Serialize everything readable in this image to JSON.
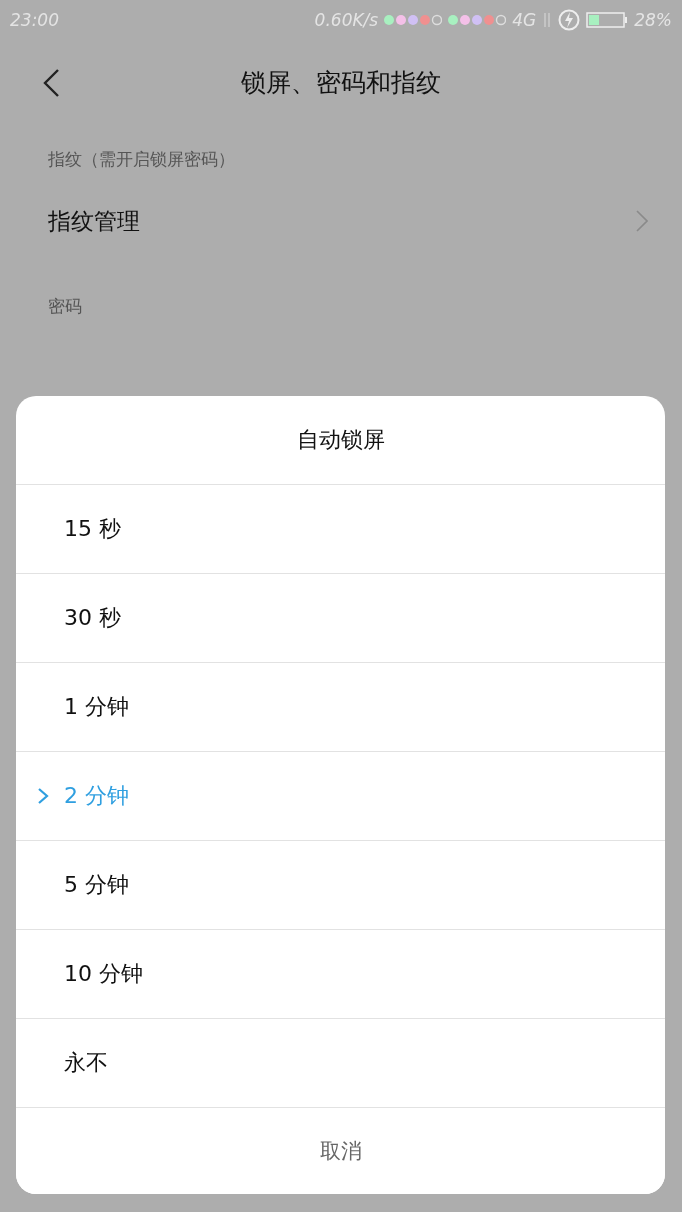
{
  "status_bar": {
    "time": "23:00",
    "speed": "0.60K/s",
    "network": "4G",
    "battery": "28%"
  },
  "header": {
    "title": "锁屏、密码和指纹"
  },
  "sections": [
    {
      "title": "指纹（需开启锁屏密码）",
      "items": [
        {
          "label": "指纹管理"
        }
      ]
    },
    {
      "title": "密码"
    }
  ],
  "dialog": {
    "title": "自动锁屏",
    "options": [
      {
        "label": "15 秒",
        "selected": false
      },
      {
        "label": "30 秒",
        "selected": false
      },
      {
        "label": "1 分钟",
        "selected": false
      },
      {
        "label": "2 分钟",
        "selected": true
      },
      {
        "label": "5 分钟",
        "selected": false
      },
      {
        "label": "10 分钟",
        "selected": false
      },
      {
        "label": "永不",
        "selected": false
      }
    ],
    "cancel": "取消"
  }
}
